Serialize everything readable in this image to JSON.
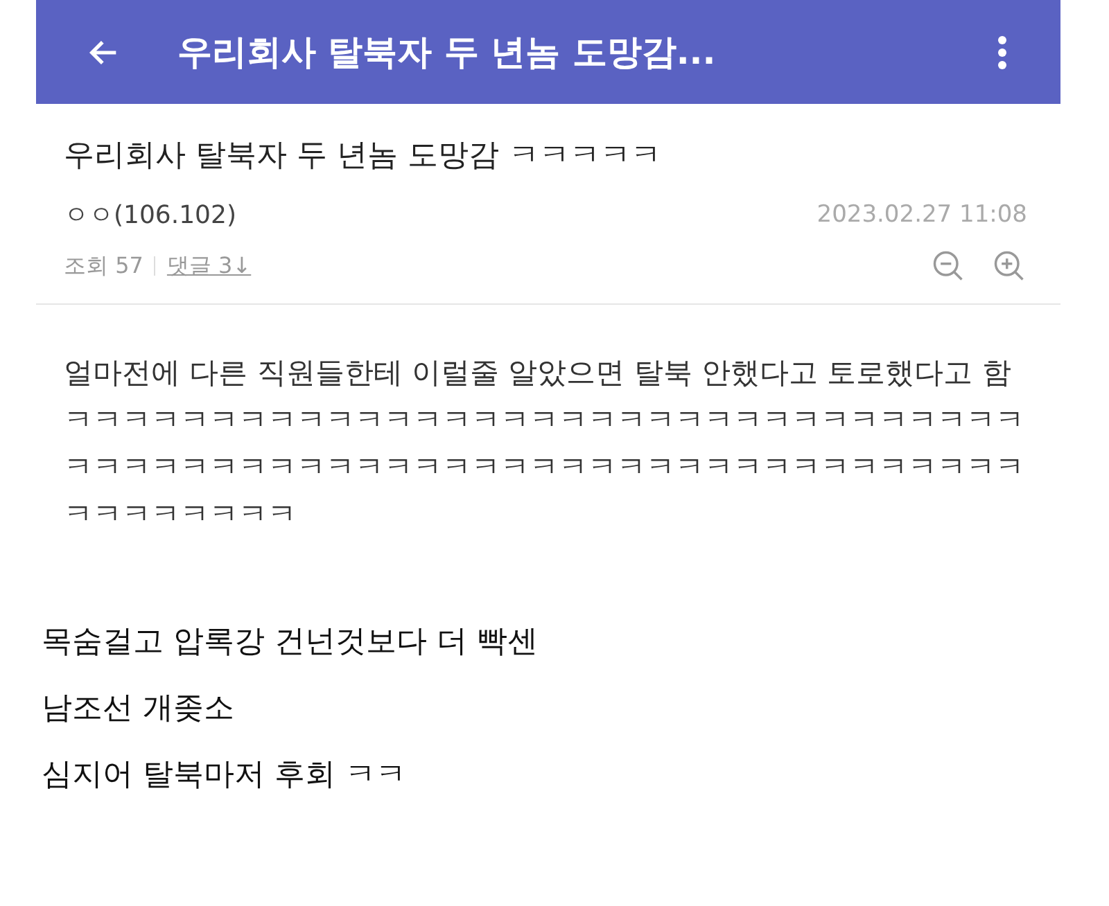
{
  "app_bar": {
    "title": "우리회사 탈북자 두 년놈 도망감..."
  },
  "post": {
    "title": "우리회사 탈북자 두 년놈 도망감 ㅋㅋㅋㅋㅋ",
    "author": "ㅇㅇ(106.102)",
    "date": "2023.02.27 11:08",
    "views": "조회 57",
    "comments": "댓글 3↓",
    "body": "얼마전에 다른 직원들한테 이럴줄 알았으면 탈북 안했다고 토로했다고 함 ㅋㅋㅋㅋㅋㅋㅋㅋㅋㅋㅋㅋㅋㅋㅋㅋㅋㅋㅋㅋㅋㅋㅋㅋㅋㅋㅋㅋㅋㅋㅋㅋㅋㅋㅋㅋㅋㅋㅋㅋㅋㅋㅋㅋㅋㅋㅋㅋㅋㅋㅋㅋㅋㅋㅋㅋㅋㅋㅋㅋㅋㅋㅋㅋㅋㅋㅋㅋㅋㅋㅋㅋㅋㅋ"
  },
  "caption": [
    "목숨걸고 압록강 건넌것보다 더 빡센",
    "남조선 개좆소",
    "심지어 탈북마저 후회 ㅋㅋ"
  ]
}
